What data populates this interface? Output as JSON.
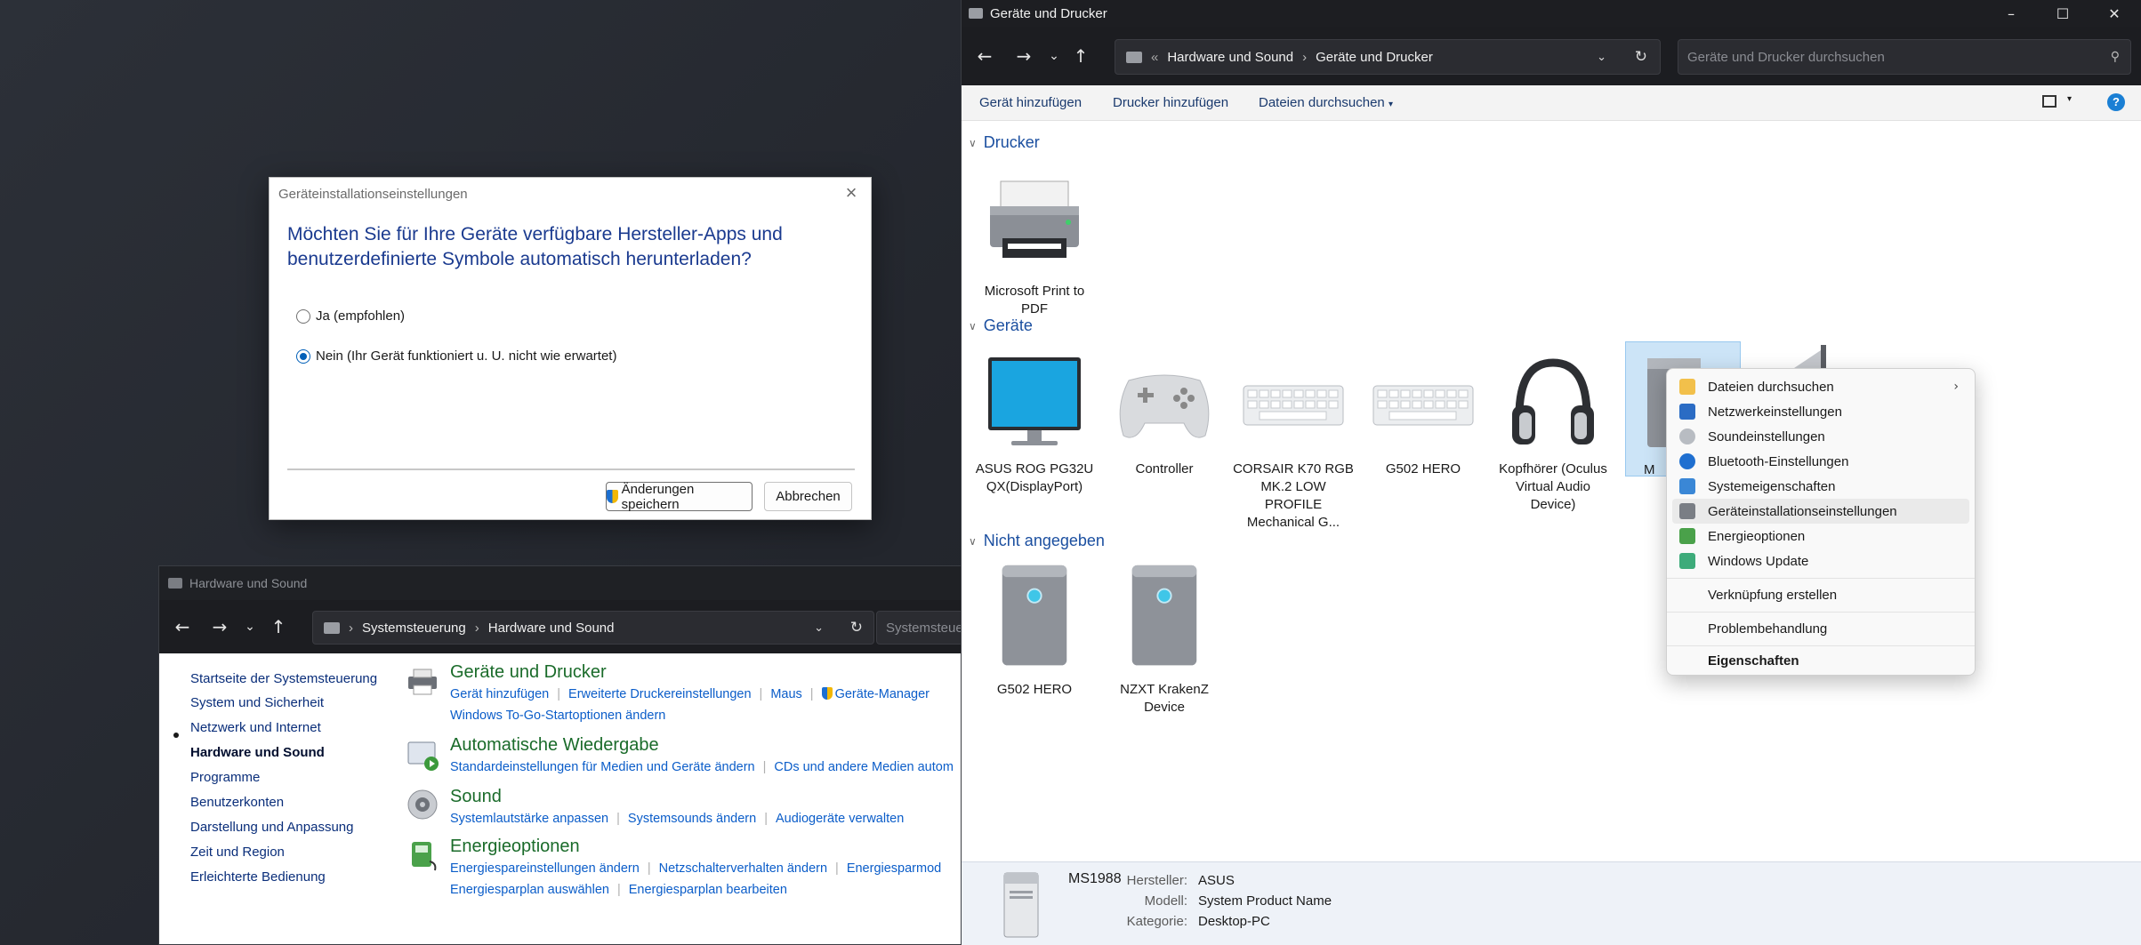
{
  "hw_window": {
    "title": "Hardware und Sound",
    "breadcrumb": [
      "Systemsteuerung",
      "Hardware und Sound"
    ],
    "search_placeholder": "Systemsteuer",
    "left_nav": [
      {
        "label": "Startseite der Systemsteuerung"
      },
      {
        "label": "System und Sicherheit"
      },
      {
        "label": "Netzwerk und Internet"
      },
      {
        "label": "Hardware und Sound",
        "active": true
      },
      {
        "label": "Programme"
      },
      {
        "label": "Benutzerkonten"
      },
      {
        "label": "Darstellung und Anpassung"
      },
      {
        "label": "Zeit und Region"
      },
      {
        "label": "Erleichterte Bedienung"
      }
    ],
    "categories": [
      {
        "title": "Geräte und Drucker",
        "icon": "printer-icon",
        "lines": [
          [
            "Gerät hinzufügen",
            "Erweiterte Druckereinstellungen",
            "Maus",
            "Geräte-Manager"
          ],
          [
            "Windows To-Go-Startoptionen ändern"
          ]
        ]
      },
      {
        "title": "Automatische Wiedergabe",
        "icon": "autoplay-icon",
        "lines": [
          [
            "Standardeinstellungen für Medien und Geräte ändern",
            "CDs und andere Medien autom"
          ]
        ]
      },
      {
        "title": "Sound",
        "icon": "speaker-icon",
        "lines": [
          [
            "Systemlautstärke anpassen",
            "Systemsounds ändern",
            "Audiogeräte verwalten"
          ]
        ]
      },
      {
        "title": "Energieoptionen",
        "icon": "power-icon",
        "lines": [
          [
            "Energiespareinstellungen ändern",
            "Netzschalterverhalten ändern",
            "Energiesparmod"
          ],
          [
            "Energiesparplan auswählen",
            "Energiesparplan bearbeiten"
          ]
        ]
      }
    ]
  },
  "dialog": {
    "title": "Geräteinstallationseinstellungen",
    "question": "Möchten Sie für Ihre Geräte verfügbare Hersteller-Apps und benutzerdefinierte Symbole automatisch herunterladen?",
    "option_yes": "Ja (empfohlen)",
    "option_no": "Nein (Ihr Gerät funktioniert u. U. nicht wie erwartet)",
    "selected": "no",
    "save_label": "Änderungen speichern",
    "cancel_label": "Abbrechen"
  },
  "gd_window": {
    "title": "Geräte und Drucker",
    "breadcrumb_prefix": "«",
    "breadcrumb": [
      "Hardware und Sound",
      "Geräte und Drucker"
    ],
    "search_placeholder": "Geräte und Drucker durchsuchen",
    "toolbar": {
      "add_device": "Gerät hinzufügen",
      "add_printer": "Drucker hinzufügen",
      "browse_files": "Dateien durchsuchen"
    },
    "groups": {
      "printers": "Drucker",
      "devices": "Geräte",
      "unspecified": "Nicht angegeben"
    },
    "printers": [
      {
        "label": "Microsoft Print to PDF",
        "icon": "printer-icon"
      }
    ],
    "devices": [
      {
        "label": "ASUS ROG PG32UQX(DisplayPort)",
        "icon": "monitor-icon"
      },
      {
        "label": "Controller",
        "icon": "gamepad-icon"
      },
      {
        "label": "CORSAIR K70 RGB MK.2 LOW PROFILE Mechanical G...",
        "icon": "keyboard-icon"
      },
      {
        "label": "G502 HERO",
        "icon": "keyboard-icon"
      },
      {
        "label": "Kopfhörer (Oculus Virtual Audio Device)",
        "icon": "headphones-icon"
      },
      {
        "label": "M",
        "icon": "pc-tower-icon",
        "selected": true
      }
    ],
    "unspecified": [
      {
        "label": "G502 HERO",
        "icon": "pc-tower-icon"
      },
      {
        "label": "NZXT KrakenZ Device",
        "icon": "pc-tower-icon"
      }
    ],
    "details": {
      "name": "MS1988",
      "manufacturer_label": "Hersteller:",
      "manufacturer": "ASUS",
      "model_label": "Modell:",
      "model": "System Product Name",
      "category_label": "Kategorie:",
      "category": "Desktop-PC"
    }
  },
  "context_menu": {
    "items": [
      {
        "label": "Dateien durchsuchen",
        "icon": "folder-icon",
        "submenu": true
      },
      {
        "label": "Netzwerkeinstellungen",
        "icon": "network-icon"
      },
      {
        "label": "Soundeinstellungen",
        "icon": "speaker-icon"
      },
      {
        "label": "Bluetooth-Einstellungen",
        "icon": "bluetooth-icon"
      },
      {
        "label": "Systemeigenschaften",
        "icon": "computer-icon"
      },
      {
        "label": "Geräteinstallationseinstellungen",
        "icon": "pc-tower-icon",
        "hover": true
      },
      {
        "label": "Energieoptionen",
        "icon": "power-icon"
      },
      {
        "label": "Windows Update",
        "icon": "windows-update-icon"
      },
      {
        "label": "Verknüpfung erstellen"
      },
      {
        "label": "Problembehandlung"
      },
      {
        "label": "Eigenschaften",
        "bold": true
      }
    ]
  },
  "colors": {
    "accent": "#005fb8",
    "link": "#0b5dc9",
    "category_title": "#1a6b2a",
    "dark_chrome": "#1c1d21"
  }
}
